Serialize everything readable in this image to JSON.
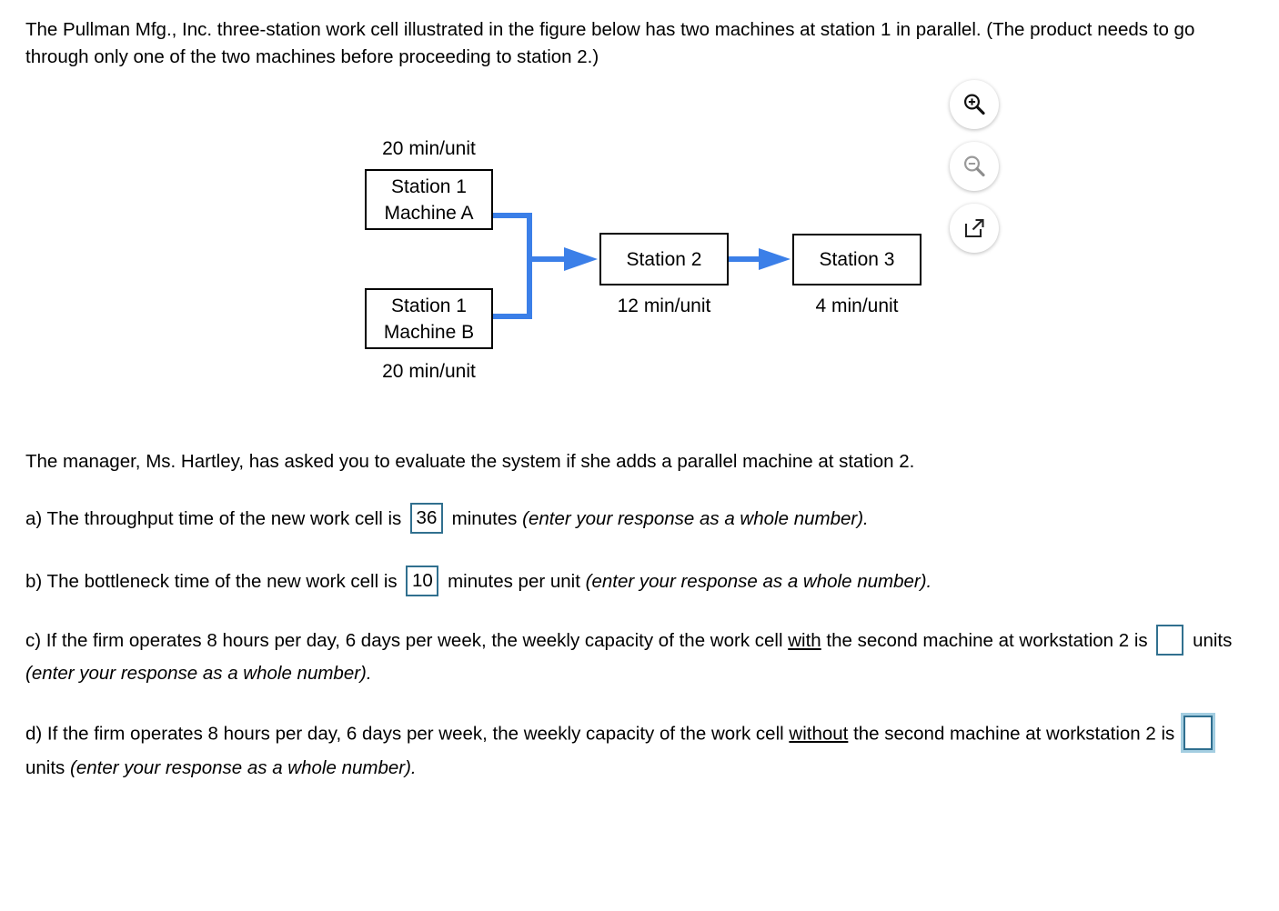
{
  "intro": {
    "line1": "The Pullman Mfg., Inc. three-station work cell illustrated in the figure below has two machines at station 1 in parallel.",
    "line2": "(The product needs to go through only one of the two machines before proceeding to station 2.)",
    "full": "The Pullman Mfg., Inc. three-station work cell illustrated in the figure below has two machines at station 1 in parallel. (The product needs to go through only one of the two machines before proceeding to station 2.)"
  },
  "tools": {
    "zoom_in": "zoom-in-icon",
    "zoom_out": "zoom-out-icon",
    "open_in_new": "open-in-new-window-icon"
  },
  "figure": {
    "accent_color": "#3b7fe8",
    "box_border_color": "#000000",
    "station1_a": {
      "line1": "Station 1",
      "line2": "Machine A",
      "time_label": "20 min/unit"
    },
    "station1_b": {
      "line1": "Station 1",
      "line2": "Machine B",
      "time_label": "20 min/unit"
    },
    "station2": {
      "label": "Station 2",
      "time_label": "12 min/unit"
    },
    "station3": {
      "label": "Station 3",
      "time_label": "4 min/unit"
    }
  },
  "manager_line": "The manager, Ms. Hartley, has asked you to evaluate the system if she adds a parallel machine at station 2.",
  "questions": {
    "a": {
      "prefix": "a) The throughput time of the new work cell is",
      "answer": "36",
      "middle": "minutes",
      "hint": "(enter your response as a whole number)."
    },
    "b": {
      "prefix": "b) The bottleneck time of the new work cell is",
      "answer": "10",
      "middle": "minutes per unit",
      "hint": "(enter your response as a whole number)."
    },
    "c": {
      "prefix": "c) If the firm operates 8 hours per day, 6 days per week, the weekly capacity of the work cell",
      "emphasis": "with",
      "suffix": "the second machine at workstation 2 is",
      "answer": "",
      "middle": "units",
      "hint": "(enter your response as a whole number)."
    },
    "d": {
      "prefix": "d) If the firm operates 8 hours per day, 6 days per week, the weekly capacity of the work cell",
      "emphasis": "without",
      "suffix": "the second machine at workstation 2 is",
      "answer": "",
      "middle": "units",
      "hint": "(enter your response as a whole number)."
    }
  },
  "colors": {
    "input_border": "#31708f",
    "input_focus_ring": "#5aa5c8",
    "arrow_blue": "#3b7fe8"
  }
}
